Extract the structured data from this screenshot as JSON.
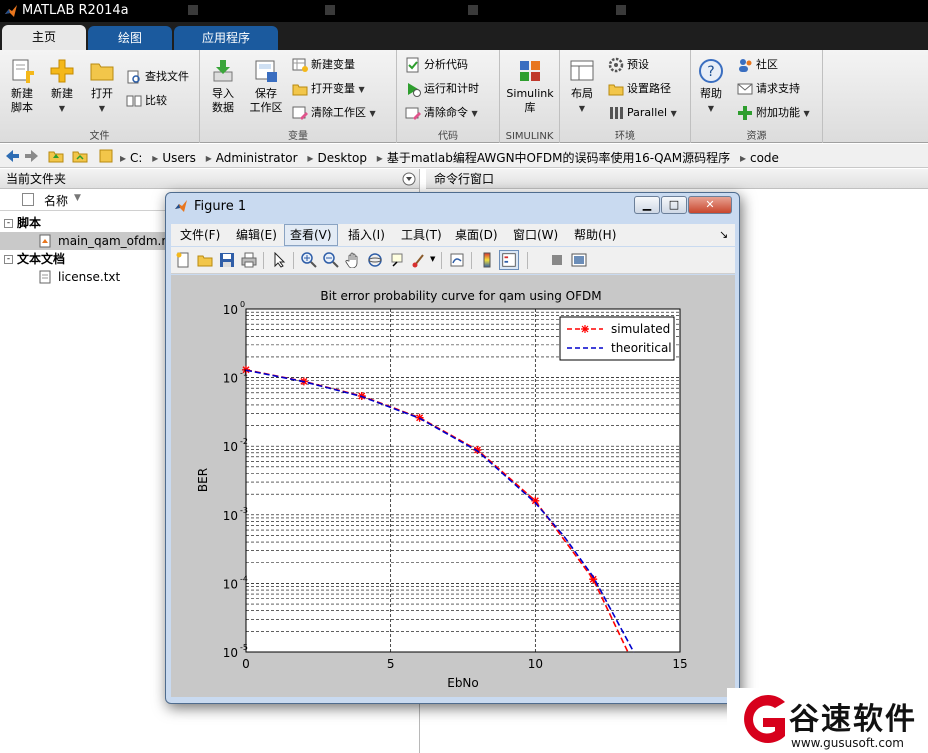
{
  "app": {
    "title": "MATLAB R2014a"
  },
  "tabs": [
    {
      "label": "主页",
      "active": true
    },
    {
      "label": "绘图",
      "active": false
    },
    {
      "label": "应用程序",
      "active": false
    }
  ],
  "ribbon": {
    "file": {
      "label": "文件",
      "new_script": [
        "新建",
        "脚本"
      ],
      "new": "新建",
      "open": "打开",
      "find_files": "查找文件",
      "compare": "比较"
    },
    "variable": {
      "label": "变量",
      "import": [
        "导入",
        "数据"
      ],
      "save": [
        "保存",
        "工作区"
      ],
      "new_var": "新建变量",
      "open_var": "打开变量",
      "clear_ws": "清除工作区"
    },
    "code": {
      "label": "代码",
      "analyze": "分析代码",
      "run_time": "运行和计时",
      "clear_cmd": "清除命令"
    },
    "simulink": {
      "label": "SIMULINK",
      "lib": [
        "Simulink",
        "库"
      ]
    },
    "env": {
      "label": "环境",
      "layout": "布局",
      "prefs": "预设",
      "set_path": "设置路径",
      "parallel": "Parallel"
    },
    "resources": {
      "label": "资源",
      "help": "帮助",
      "community": "社区",
      "support": "请求支持",
      "addons": "附加功能"
    }
  },
  "address": {
    "path": [
      "C:",
      "Users",
      "Administrator",
      "Desktop",
      "基于matlab编程AWGN中OFDM的误码率使用16-QAM源码程序",
      "code"
    ]
  },
  "left_panel": {
    "title": "当前文件夹",
    "col_name": "名称",
    "groups": [
      {
        "name": "脚本",
        "files": [
          "main_qam_ofdm.m"
        ]
      },
      {
        "name": "文本文档",
        "files": [
          "license.txt"
        ]
      }
    ]
  },
  "right_panel": {
    "title": "命令行窗口"
  },
  "figure": {
    "title": "Figure 1",
    "menu": [
      "文件(F)",
      "编辑(E)",
      "查看(V)",
      "插入(I)",
      "工具(T)",
      "桌面(D)",
      "窗口(W)",
      "帮助(H)"
    ],
    "menu_arrow": "↘"
  },
  "chart_data": {
    "type": "line",
    "title": "Bit error probability curve for qam using OFDM",
    "xlabel": "EbNo",
    "ylabel": "BER",
    "xlim": [
      0,
      15
    ],
    "ylim": [
      1e-05,
      1
    ],
    "yscale": "log",
    "grid": true,
    "xticks": [
      "0",
      "5",
      "10",
      "15"
    ],
    "yticks": [
      {
        "base": "10",
        "exp": "0"
      },
      {
        "base": "10",
        "exp": "-1"
      },
      {
        "base": "10",
        "exp": "-2"
      },
      {
        "base": "10",
        "exp": "-3"
      },
      {
        "base": "10",
        "exp": "-4"
      },
      {
        "base": "10",
        "exp": "-5"
      }
    ],
    "legend_position": "top-right",
    "series": [
      {
        "name": "simulated",
        "color": "#ff0000",
        "style": "dashed-star",
        "x": [
          0,
          2,
          4,
          6,
          8,
          10,
          12,
          13.2
        ],
        "y": [
          0.13,
          0.088,
          0.054,
          0.026,
          0.0088,
          0.0016,
          0.000115,
          1e-05
        ]
      },
      {
        "name": "theoritical",
        "color": "#0000cc",
        "style": "dashed",
        "x": [
          0,
          2,
          4,
          6,
          8,
          10,
          11,
          12,
          13.4
        ],
        "y": [
          0.128,
          0.087,
          0.053,
          0.0255,
          0.0085,
          0.0015,
          0.00048,
          0.000125,
          1e-05
        ]
      }
    ]
  },
  "watermark": {
    "brand": "谷速软件",
    "url": "www.gususoft.com",
    "color": "#d7001c"
  }
}
